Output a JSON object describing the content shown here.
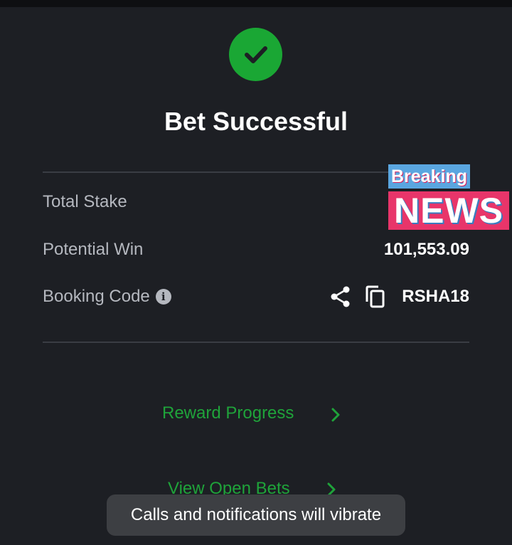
{
  "title": "Bet Successful",
  "rows": {
    "total_stake_label": "Total Stake",
    "potential_win_label": "Potential Win",
    "potential_win_value": "101,553.09",
    "booking_code_label": "Booking Code",
    "booking_code_value": "RSHA18"
  },
  "links": {
    "reward_progress": "Reward Progress",
    "view_open_bets": "View Open Bets"
  },
  "overlay": {
    "breaking": "Breaking",
    "news": "NEWS"
  },
  "toast": "Calls and notifications will vibrate",
  "icons": {
    "success": "check-circle-icon",
    "info": "info-icon",
    "share": "share-icon",
    "copy": "copy-icon",
    "chevron": "chevron-right-icon"
  },
  "colors": {
    "background": "#1d1f24",
    "success_green": "#1aa734",
    "link_green": "#1fa33a"
  }
}
